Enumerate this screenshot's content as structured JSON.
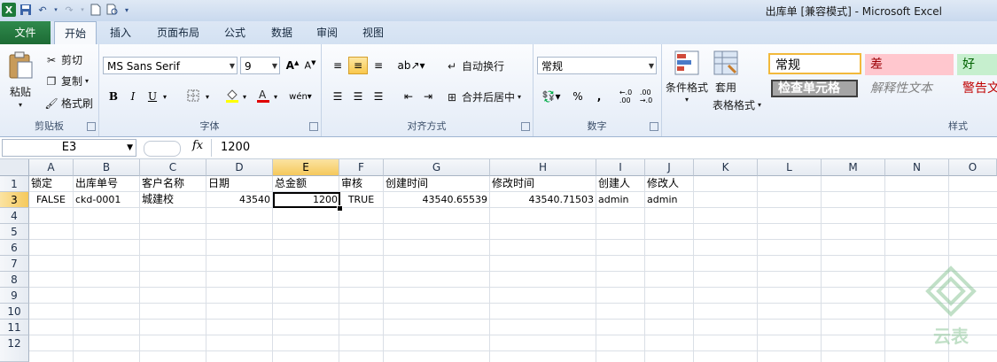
{
  "window": {
    "title": "出库单  [兼容模式]  -  Microsoft Excel"
  },
  "tabs": [
    {
      "label": "文件"
    },
    {
      "label": "开始"
    },
    {
      "label": "插入"
    },
    {
      "label": "页面布局"
    },
    {
      "label": "公式"
    },
    {
      "label": "数据"
    },
    {
      "label": "审阅"
    },
    {
      "label": "视图"
    }
  ],
  "ribbon": {
    "clipboard": {
      "paste": "粘贴",
      "cut": "剪切",
      "copy": "复制",
      "format_painter": "格式刷",
      "label": "剪贴板"
    },
    "font": {
      "name": "MS Sans Serif",
      "size": "9",
      "label": "字体",
      "bold": "B",
      "italic": "I",
      "underline": "U"
    },
    "alignment": {
      "wrap": "自动换行",
      "merge": "合并后居中",
      "label": "对齐方式"
    },
    "number": {
      "format": "常规",
      "percent": "%",
      "comma": ",",
      "label": "数字"
    },
    "styles": {
      "conditional": "条件格式",
      "table_format_1": "套用",
      "table_format_2": "表格格式",
      "normal": "常规",
      "bad": "差",
      "good": "好",
      "check_cell": "检查单元格",
      "explanatory": "解释性文本",
      "warning": "警告文",
      "label": "样式"
    }
  },
  "formula_bar": {
    "name_box": "E3",
    "fx": "fx",
    "content": "1200"
  },
  "sheet": {
    "columns": [
      "A",
      "B",
      "C",
      "D",
      "E",
      "F",
      "G",
      "H",
      "I",
      "J",
      "K",
      "L",
      "M",
      "N",
      "O"
    ],
    "rows": [
      "1",
      "3",
      "4",
      "5",
      "6",
      "7",
      "8",
      "9",
      "10",
      "11",
      "12"
    ],
    "header_row": [
      "锁定",
      "出库单号",
      "客户名称",
      "日期",
      "总金额",
      "审核",
      "创建时间",
      "修改时间",
      "创建人",
      "修改人"
    ],
    "data_row": [
      "FALSE",
      "ckd-0001",
      "城建校",
      "43540",
      "1200",
      "TRUE",
      "43540.65539",
      "43540.71503",
      "admin",
      "admin"
    ],
    "active_cell": "E3"
  },
  "watermark": {
    "text": "云表"
  },
  "colors": {
    "file_tab": "#1d6b35",
    "selection_header": "#f5c95c",
    "style_bad_bg": "#ffc7ce",
    "style_good_bg": "#c6efce",
    "warning_text": "#c00000"
  }
}
